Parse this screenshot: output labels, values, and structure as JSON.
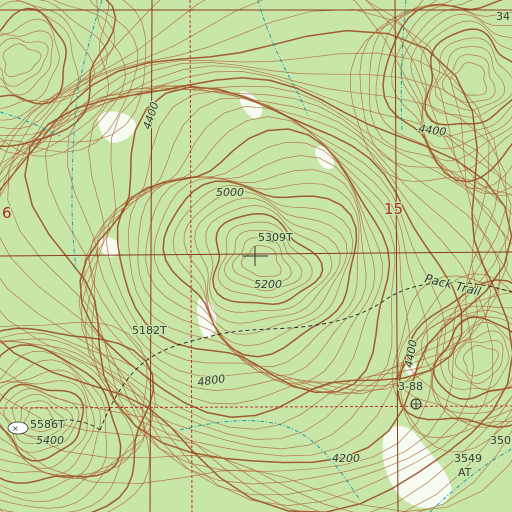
{
  "map": {
    "background": "#c8e6a8",
    "contour_color": "#b0663a",
    "water_color": "#1f9fa8",
    "grid_color": "#8a3a22",
    "clearing_color": "#ffffff",
    "elevation_labels": {
      "e4400_a": "4400",
      "e4400_b": "4400",
      "e5000": "5000",
      "e5200": "5200",
      "e4800": "4800",
      "e4200": "4200",
      "e5400": "5400",
      "e4400_c": "4400"
    },
    "spot_elevations": {
      "summit": "5309T",
      "spot_5182": "5182T",
      "spot_5586": "5586T",
      "spot_3549": "3549",
      "spot_3549_suffix": "AT",
      "spot_350": "350"
    },
    "section_labels": {
      "sec15": "15",
      "sec6": "6"
    },
    "trail_label": "Pack Trail",
    "benchmark_label": "3-88",
    "edge_top_right": "34"
  }
}
